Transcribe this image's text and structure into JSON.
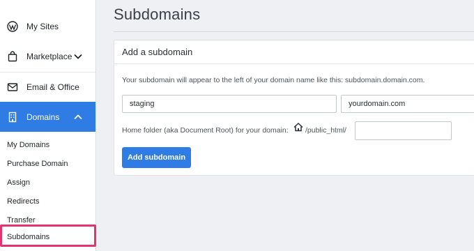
{
  "sidebar": {
    "items": [
      {
        "label": "My Sites",
        "icon": "wordpress-icon"
      },
      {
        "label": "Marketplace",
        "icon": "shopping-bag-icon"
      },
      {
        "label": "Email & Office",
        "icon": "envelope-icon"
      },
      {
        "label": "Domains",
        "icon": "building-icon"
      }
    ],
    "sub_items": [
      {
        "label": "My Domains"
      },
      {
        "label": "Purchase Domain"
      },
      {
        "label": "Assign"
      },
      {
        "label": "Redirects"
      },
      {
        "label": "Transfer"
      },
      {
        "label": "Subdomains"
      }
    ],
    "active_item": "Domains",
    "selected_sub_item": "Subdomains"
  },
  "main": {
    "title": "Subdomains",
    "card": {
      "title": "Add a subdomain",
      "help_text": "Your subdomain will appear to the left of your domain name like this: subdomain.domain.com.",
      "subdomain_value": "staging",
      "domain_value": "yourdomain.com",
      "folder_label": "Home folder (aka Document Root) for your domain:",
      "folder_path": "/public_html/",
      "folder_value": "",
      "button_label": "Add subdomain"
    }
  },
  "colors": {
    "accent": "#2f7ce4",
    "highlight": "#e5336e",
    "background": "#eef0f3"
  }
}
